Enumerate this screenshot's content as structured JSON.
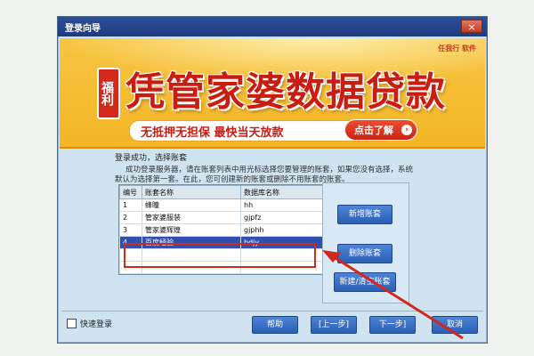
{
  "window": {
    "title": "登录向导",
    "close_label": "×"
  },
  "banner": {
    "badge": "福利",
    "headline": "凭管家婆数据贷款",
    "subtitle": "无抵押无担保  最快当天放款",
    "cta_label": "点击了解",
    "cta_icon": "arrow-right-icon",
    "logo_text": "任我行 软件"
  },
  "content": {
    "status": "登录成功，选择账套",
    "description": "成功登录服务器，请在账套列表中用光标选择您要管理的账套，如果您没有选择，系统默认为选择第一套。在此，您可创建新的账套或删除不用账套的账套。"
  },
  "table": {
    "headers": [
      "编号",
      "账套名称",
      "数据库名称"
    ],
    "rows": [
      [
        "1",
        "蜂瞳",
        "hh"
      ],
      [
        "2",
        "管家婆服装",
        "gjpfz"
      ],
      [
        "3",
        "管家婆辉煌",
        "gjphh"
      ],
      [
        "4",
        "百度经验",
        "bdjy"
      ]
    ],
    "selected_index": 3
  },
  "side_buttons": {
    "new": "新增账套",
    "delete": "删除账套",
    "rebuild": "新建/清空账套"
  },
  "footer": {
    "quick_login": "快速登录",
    "help": "帮助",
    "prev": "[上一步]",
    "next": "下一步]",
    "cancel": "取消"
  },
  "colors": {
    "banner_red": "#c91d12",
    "banner_yellow": "#f4b526",
    "button_blue": "#2a5fb4",
    "selected_row": "#2f50ae",
    "annotation_red": "#d4281b"
  }
}
